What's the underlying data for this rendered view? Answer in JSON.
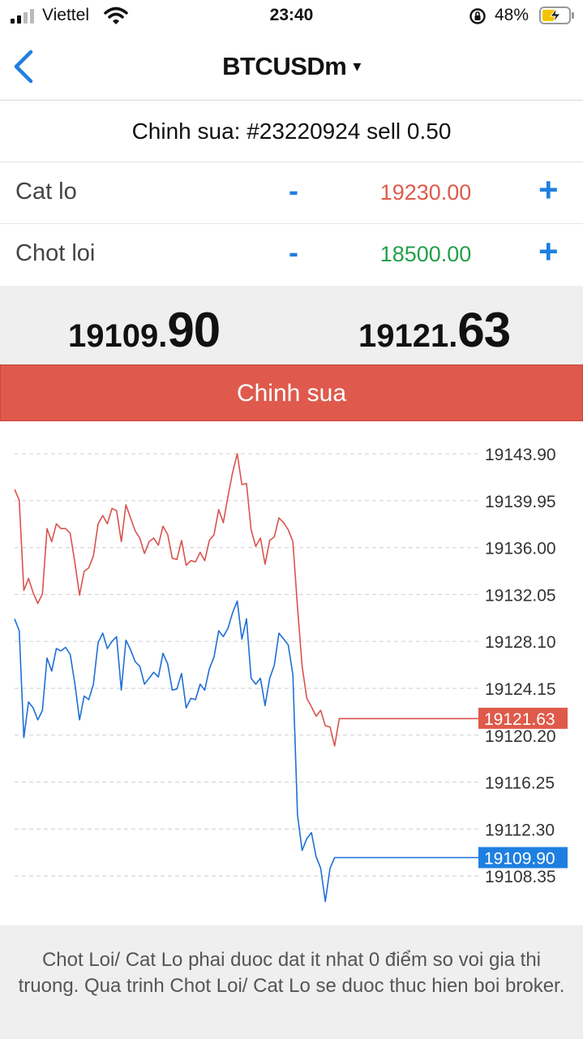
{
  "status_bar": {
    "carrier": "Viettel",
    "time": "23:40",
    "battery_percent": "48%",
    "icons": [
      "signal-icon",
      "wifi-icon",
      "rotation-lock-icon",
      "battery-charging-icon"
    ]
  },
  "header": {
    "symbol": "BTCUSDm",
    "dropdown_caret": "▾",
    "back_icon": "chevron-left-icon"
  },
  "order": {
    "title": "Chinh sua: #23220924 sell 0.50"
  },
  "stop_loss": {
    "label": "Cat lo",
    "minus": "-",
    "value": "19230.00",
    "plus": "+",
    "color": "#df5a4a"
  },
  "take_profit": {
    "label": "Chot loi",
    "minus": "-",
    "value": "18500.00",
    "plus": "+",
    "color": "#23a04a"
  },
  "quotes": {
    "bid_main": "19109.",
    "bid_big": "90",
    "ask_main": "19121.",
    "ask_big": "63"
  },
  "submit_label": "Chinh sua",
  "chart_data": {
    "type": "line",
    "title": "",
    "xlabel": "",
    "ylabel": "",
    "grid": true,
    "ylim": [
      19104.4,
      19147.85
    ],
    "y_ticks": [
      "19143.90",
      "19139.95",
      "19136.00",
      "19132.05",
      "19128.10",
      "19124.15",
      "19120.20",
      "19116.25",
      "19112.30",
      "19108.35"
    ],
    "current_ask": "19121.63",
    "current_bid": "19109.90",
    "colors": {
      "ask": "#d9534f",
      "bid": "#1f6fd6",
      "ask_tag": "#df5a4a",
      "bid_tag": "#1f7fe0"
    },
    "x": [
      0,
      1,
      2,
      3,
      4,
      5,
      6,
      7,
      8,
      9,
      10,
      11,
      12,
      13,
      14,
      15,
      16,
      17,
      18,
      19,
      20,
      21,
      22,
      23,
      24,
      25,
      26,
      27,
      28,
      29,
      30,
      31,
      32,
      33,
      34,
      35,
      36,
      37,
      38,
      39,
      40,
      41,
      42,
      43,
      44,
      45,
      46,
      47,
      48,
      49,
      50,
      51,
      52,
      53,
      54,
      55,
      56,
      57,
      58,
      59,
      60,
      61,
      62,
      63,
      64,
      65,
      66,
      67,
      68,
      69,
      70,
      71,
      72,
      73,
      74,
      75,
      76,
      77,
      78,
      79,
      80,
      81,
      82,
      83,
      84,
      85,
      86,
      87,
      88,
      89,
      90,
      91,
      92,
      93,
      94,
      95,
      96,
      97,
      98,
      99,
      100
    ],
    "series": [
      {
        "values": [
          19140.9,
          19140.0,
          19132.4,
          19133.4,
          19132.2,
          19131.3,
          19132.1,
          19137.6,
          19136.5,
          19138.0,
          19137.6,
          19137.6,
          19137.2,
          19134.7,
          19132.0,
          19134.0,
          19134.3,
          19135.3,
          19138.0,
          19138.7,
          19138.0,
          19139.3,
          19139.1,
          19136.5,
          19139.6,
          19138.5,
          19137.4,
          19136.8,
          19135.5,
          19136.5,
          19136.8,
          19136.2,
          19137.8,
          19137.1,
          19135.1,
          19135.0,
          19136.6,
          19134.5,
          19134.9,
          19134.8,
          19135.6,
          19134.9,
          19136.6,
          19137.1,
          19139.2,
          19138.1,
          19140.3,
          19142.3,
          19143.9,
          19141.3,
          19141.4,
          19137.5,
          19136.1,
          19136.8,
          19134.6,
          19136.6,
          19136.9,
          19138.5,
          19138.1,
          19137.5,
          19136.5,
          19131.0,
          19126.0,
          19123.3,
          19122.6,
          19121.8,
          19122.3,
          19121.0,
          19120.9,
          19119.3,
          19121.6,
          19121.6,
          19121.6,
          19121.6,
          19121.6,
          19121.6,
          19121.6,
          19121.6,
          19121.6,
          19121.6,
          19121.6,
          19121.6,
          19121.6,
          19121.6,
          19121.6,
          19121.6,
          19121.6,
          19121.6,
          19121.6,
          19121.6,
          19121.6,
          19121.6,
          19121.6,
          19121.6,
          19121.6,
          19121.6,
          19121.6,
          19121.6,
          19121.6,
          19121.6,
          19121.6
        ]
      },
      {
        "values": [
          19130.0,
          19129.0,
          19120.0,
          19123.0,
          19122.5,
          19121.5,
          19122.3,
          19126.7,
          19125.6,
          19127.5,
          19127.3,
          19127.6,
          19127.0,
          19124.5,
          19121.5,
          19123.5,
          19123.2,
          19124.5,
          19128.0,
          19128.8,
          19127.5,
          19128.1,
          19128.5,
          19124.0,
          19128.2,
          19127.4,
          19126.4,
          19126.0,
          19124.5,
          19125.0,
          19125.5,
          19125.1,
          19127.1,
          19126.2,
          19124.0,
          19124.1,
          19125.4,
          19122.5,
          19123.3,
          19123.2,
          19124.5,
          19124.0,
          19125.8,
          19126.8,
          19129.0,
          19128.5,
          19129.2,
          19130.5,
          19131.5,
          19128.3,
          19130.0,
          19125.0,
          19124.5,
          19125.0,
          19122.7,
          19125.0,
          19126.1,
          19128.8,
          19128.3,
          19127.8,
          19125.3,
          19113.5,
          19110.5,
          19111.5,
          19112.0,
          19110.0,
          19109.0,
          19106.2,
          19109.0,
          19109.9,
          19109.9,
          19109.9,
          19109.9,
          19109.9,
          19109.9,
          19109.9,
          19109.9,
          19109.9,
          19109.9,
          19109.9,
          19109.9,
          19109.9,
          19109.9,
          19109.9,
          19109.9,
          19109.9,
          19109.9,
          19109.9,
          19109.9,
          19109.9,
          19109.9,
          19109.9,
          19109.9,
          19109.9,
          19109.9,
          19109.9,
          19109.9,
          19109.9,
          19109.9,
          19109.9,
          19109.9
        ]
      }
    ]
  },
  "footer_text": "Chot Loi/ Cat Lo phai duoc dat it nhat 0 điểm so voi gia thi truong. Qua trinh Chot Loi/ Cat Lo se duoc thuc hien boi broker."
}
